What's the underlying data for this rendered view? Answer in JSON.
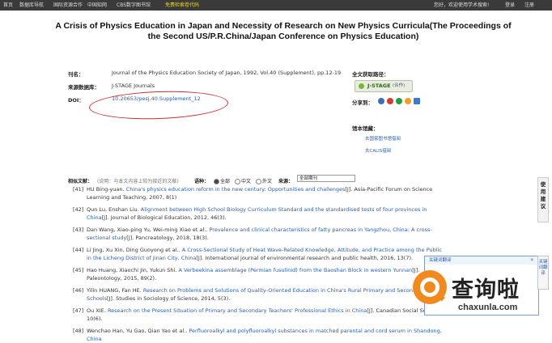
{
  "topbar": {
    "nav": [
      "首页",
      "数据库导航",
      "国际资源合作",
      "中国知网",
      "CBS数字图书馆",
      "免费检索卷代码"
    ],
    "right": [
      "您好，欢迎使用学术搜索!",
      "登录",
      "注册"
    ]
  },
  "title": "A Crisis of Physics Education in Japan and Necessity of Research on New Physics Curricula(The Proceedings of the Second US/P.R.China/Japan Conference on Physics Education)",
  "meta": {
    "source_label": "刊名：",
    "source_value": "Journal of the Physics Education Society of Japan, 1992, Vol.40 (Supplement), pp.12-19",
    "db_label": "来源数据库：",
    "db_value": "J-STAGE Journals",
    "doi_label": "DOI：",
    "doi_value": "10.20653/pesj.40.Supplement_12"
  },
  "side": {
    "fulltext_label": "全文获取路径：",
    "jstage_label": "J-STAGE",
    "jstage_note": "(合作)",
    "share_label": "分享到：",
    "holdings_label": "馆本馆藏：",
    "link_national": "去国家图书馆借阅",
    "link_calis": "去CALIS借阅"
  },
  "vertical_tab": "使用建议",
  "filter": {
    "label": "相似文献：",
    "hint": "(说明：与本文内容上较为接近的文献)",
    "lang_label": "语种：",
    "options": [
      "全部",
      "中文",
      "外文"
    ],
    "selected": "全部",
    "source_label": "来源：",
    "source_select": "全部期刊"
  },
  "refs": [
    {
      "num": "[41]",
      "authors": "HU Bing-yuan.",
      "title": "China's physics education reform in the new century: Opportunities and challenges",
      "tail": "[J]. Asia-Pacific Forum on Science Learning and Teaching, 2007, 8(1)"
    },
    {
      "num": "[42]",
      "authors": "Qun Lu, Enshan Liu.",
      "title": "Alignment between High School Biology Curriculum Standard and the standardised tests of four provinces in China",
      "tail": "[J]. Journal of Biological Education, 2012, 46(3)."
    },
    {
      "num": "[43]",
      "authors": "Dan Wang, Xiao-ping Yu, Wei-ming Xiao et al..",
      "title": "Prevalence and clinical characteristics of fatty pancreas in Yangzhou, China: A cross-sectional study",
      "tail": "[J]. Pancreatology, 2018, 18(3)."
    },
    {
      "num": "[44]",
      "authors": "Li Jing, Xu Xin, Ding Guoyong et al..",
      "title": "A Cross-Sectional Study of Heat Wave-Related Knowledge, Attitude, and Practice among the Public in the Licheng District of Jinan City, China",
      "tail": "[J]. International journal of environmental research and public health, 2016, 13(7)."
    },
    {
      "num": "[45]",
      "authors": "Hao Huang, Xiaochi Jin, Yukun Shi.",
      "title": "A Verbeekina assemblage (Permian fusulinid) from the Baoshan Block in western Yunnan",
      "tail": "[J]. Paleontology, 2015, 89(2)."
    },
    {
      "num": "[46]",
      "authors": "Yilin HUANG, Fan HE.",
      "title": "Research on Problems and Solutions of Quality-Oriented Education in China's Rural Primary and Secondary Schools",
      "tail": "[J]. Studies in Sociology of Science, 2014, 5(3)."
    },
    {
      "num": "[47]",
      "authors": "Ou XIE.",
      "title": "Research on the Present Situation of Primary and Secondary Teachers' Professional Ethics in China",
      "tail": "[J]. Canadian Social Science, 10(6)."
    },
    {
      "num": "[48]",
      "authors": "Wenchao Han, Yu Gao, Qian Yao et al..",
      "title": "Perfluoroalkyl and polyfluoroalkyl substances in matched parental and cord serum in Shandong, China",
      "tail": ""
    }
  ],
  "translate_panel": {
    "title": "关键词翻译",
    "tab": "关键词翻译"
  },
  "watermark": {
    "cn": "查询啦",
    "en": "chaxunla.com"
  },
  "colors": {
    "topbar": "#3a3a3a",
    "link": "#2a5db0",
    "annotation": "#c83030",
    "brand": "#f08a1e"
  }
}
